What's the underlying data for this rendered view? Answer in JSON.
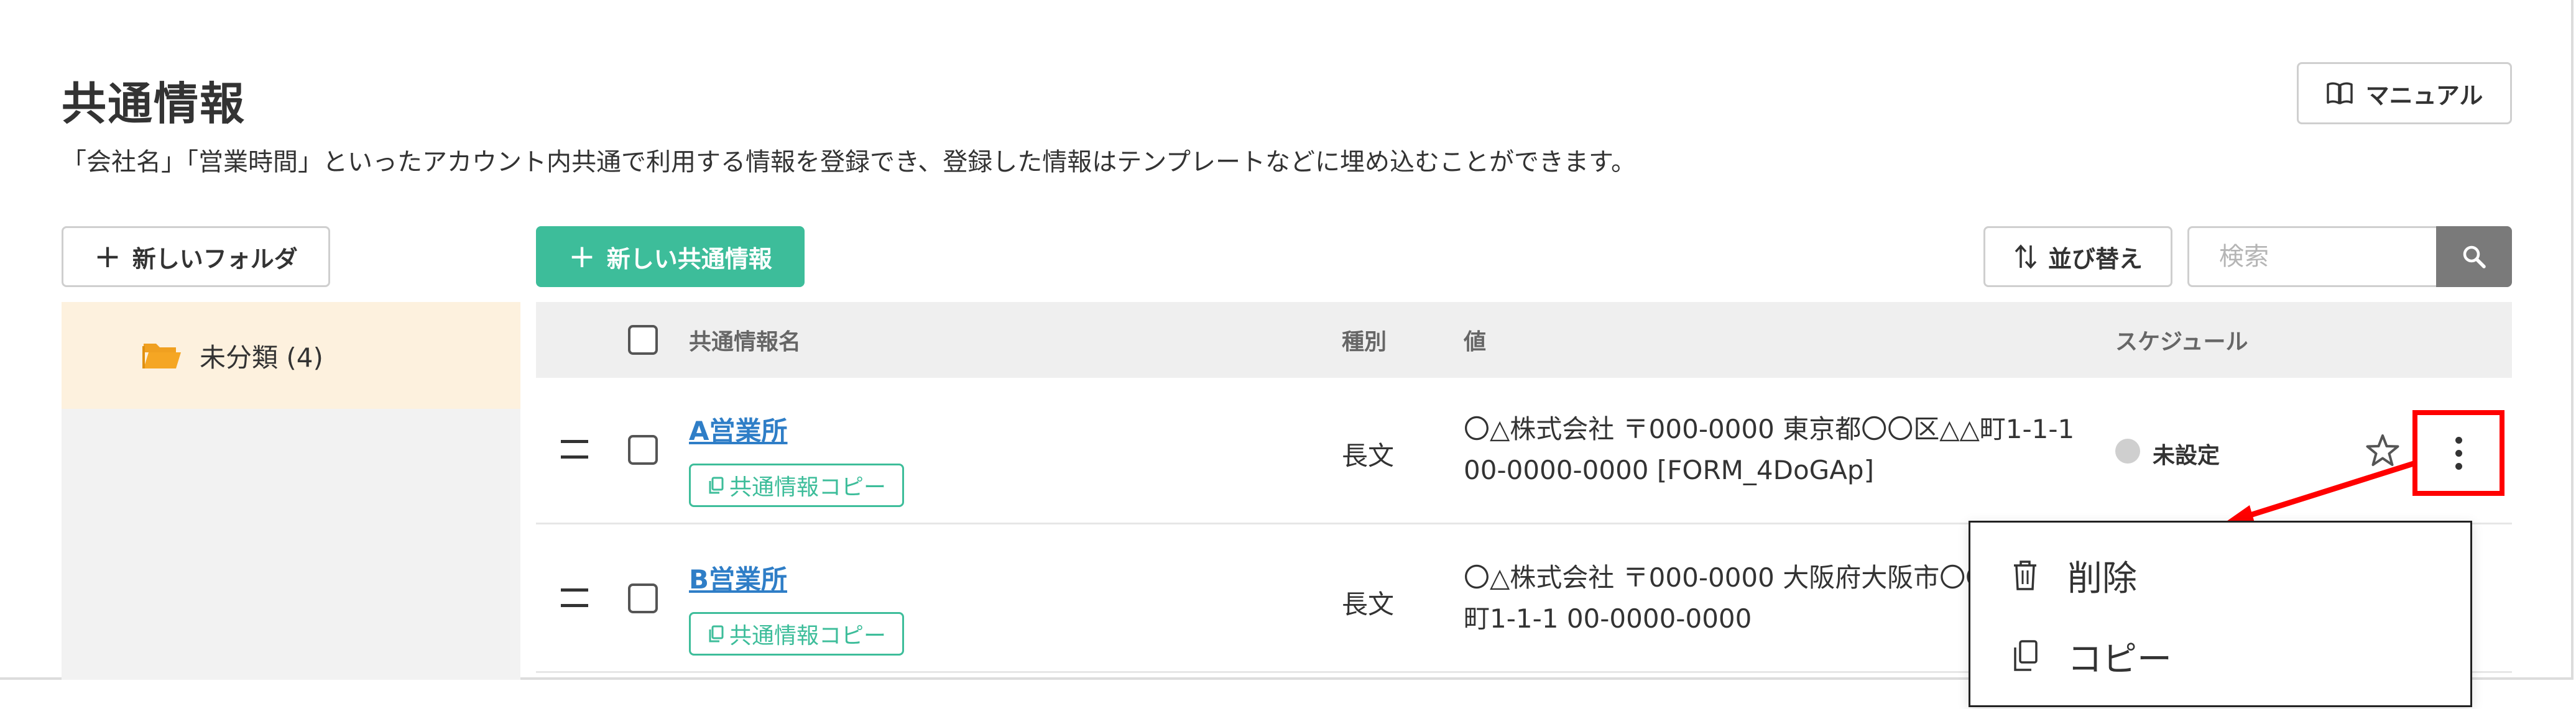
{
  "page": {
    "title": "共通情報",
    "description": "「会社名」「営業時間」といったアカウント内共通で利用する情報を登録でき、登録した情報はテンプレートなどに埋め込むことができます。",
    "manual_label": "マニュアル"
  },
  "toolbar": {
    "new_folder_label": "新しいフォルダ",
    "new_common_label": "新しい共通情報",
    "sort_label": "並び替え",
    "search_placeholder": "検索"
  },
  "sidebar": {
    "folders": [
      {
        "label": "未分類 (4)"
      }
    ]
  },
  "table": {
    "headers": {
      "name": "共通情報名",
      "type": "種別",
      "value": "値",
      "schedule": "スケジュール"
    },
    "rows": [
      {
        "name": "A営業所",
        "copy_label": "共通情報コピー",
        "type": "長文",
        "value_line1": "〇△株式会社 〒000-0000 東京都〇〇区△△町1-1-1",
        "value_line2": "00-0000-0000 [FORM_4DoGAp]",
        "schedule": "未設定"
      },
      {
        "name": "B営業所",
        "copy_label": "共通情報コピー",
        "type": "長文",
        "value_line1": "〇△株式会社 〒000-0000 大阪府大阪市〇〇",
        "value_line2": "町1-1-1 00-0000-0000"
      }
    ]
  },
  "context_menu": {
    "items": [
      {
        "label": "削除",
        "icon": "trash-icon"
      },
      {
        "label": "コピー",
        "icon": "copy-icon"
      }
    ]
  },
  "colors": {
    "accent": "#3dbd9a",
    "link": "#2f7ec7",
    "highlight": "#ff0000",
    "folder": "#f0a020"
  }
}
